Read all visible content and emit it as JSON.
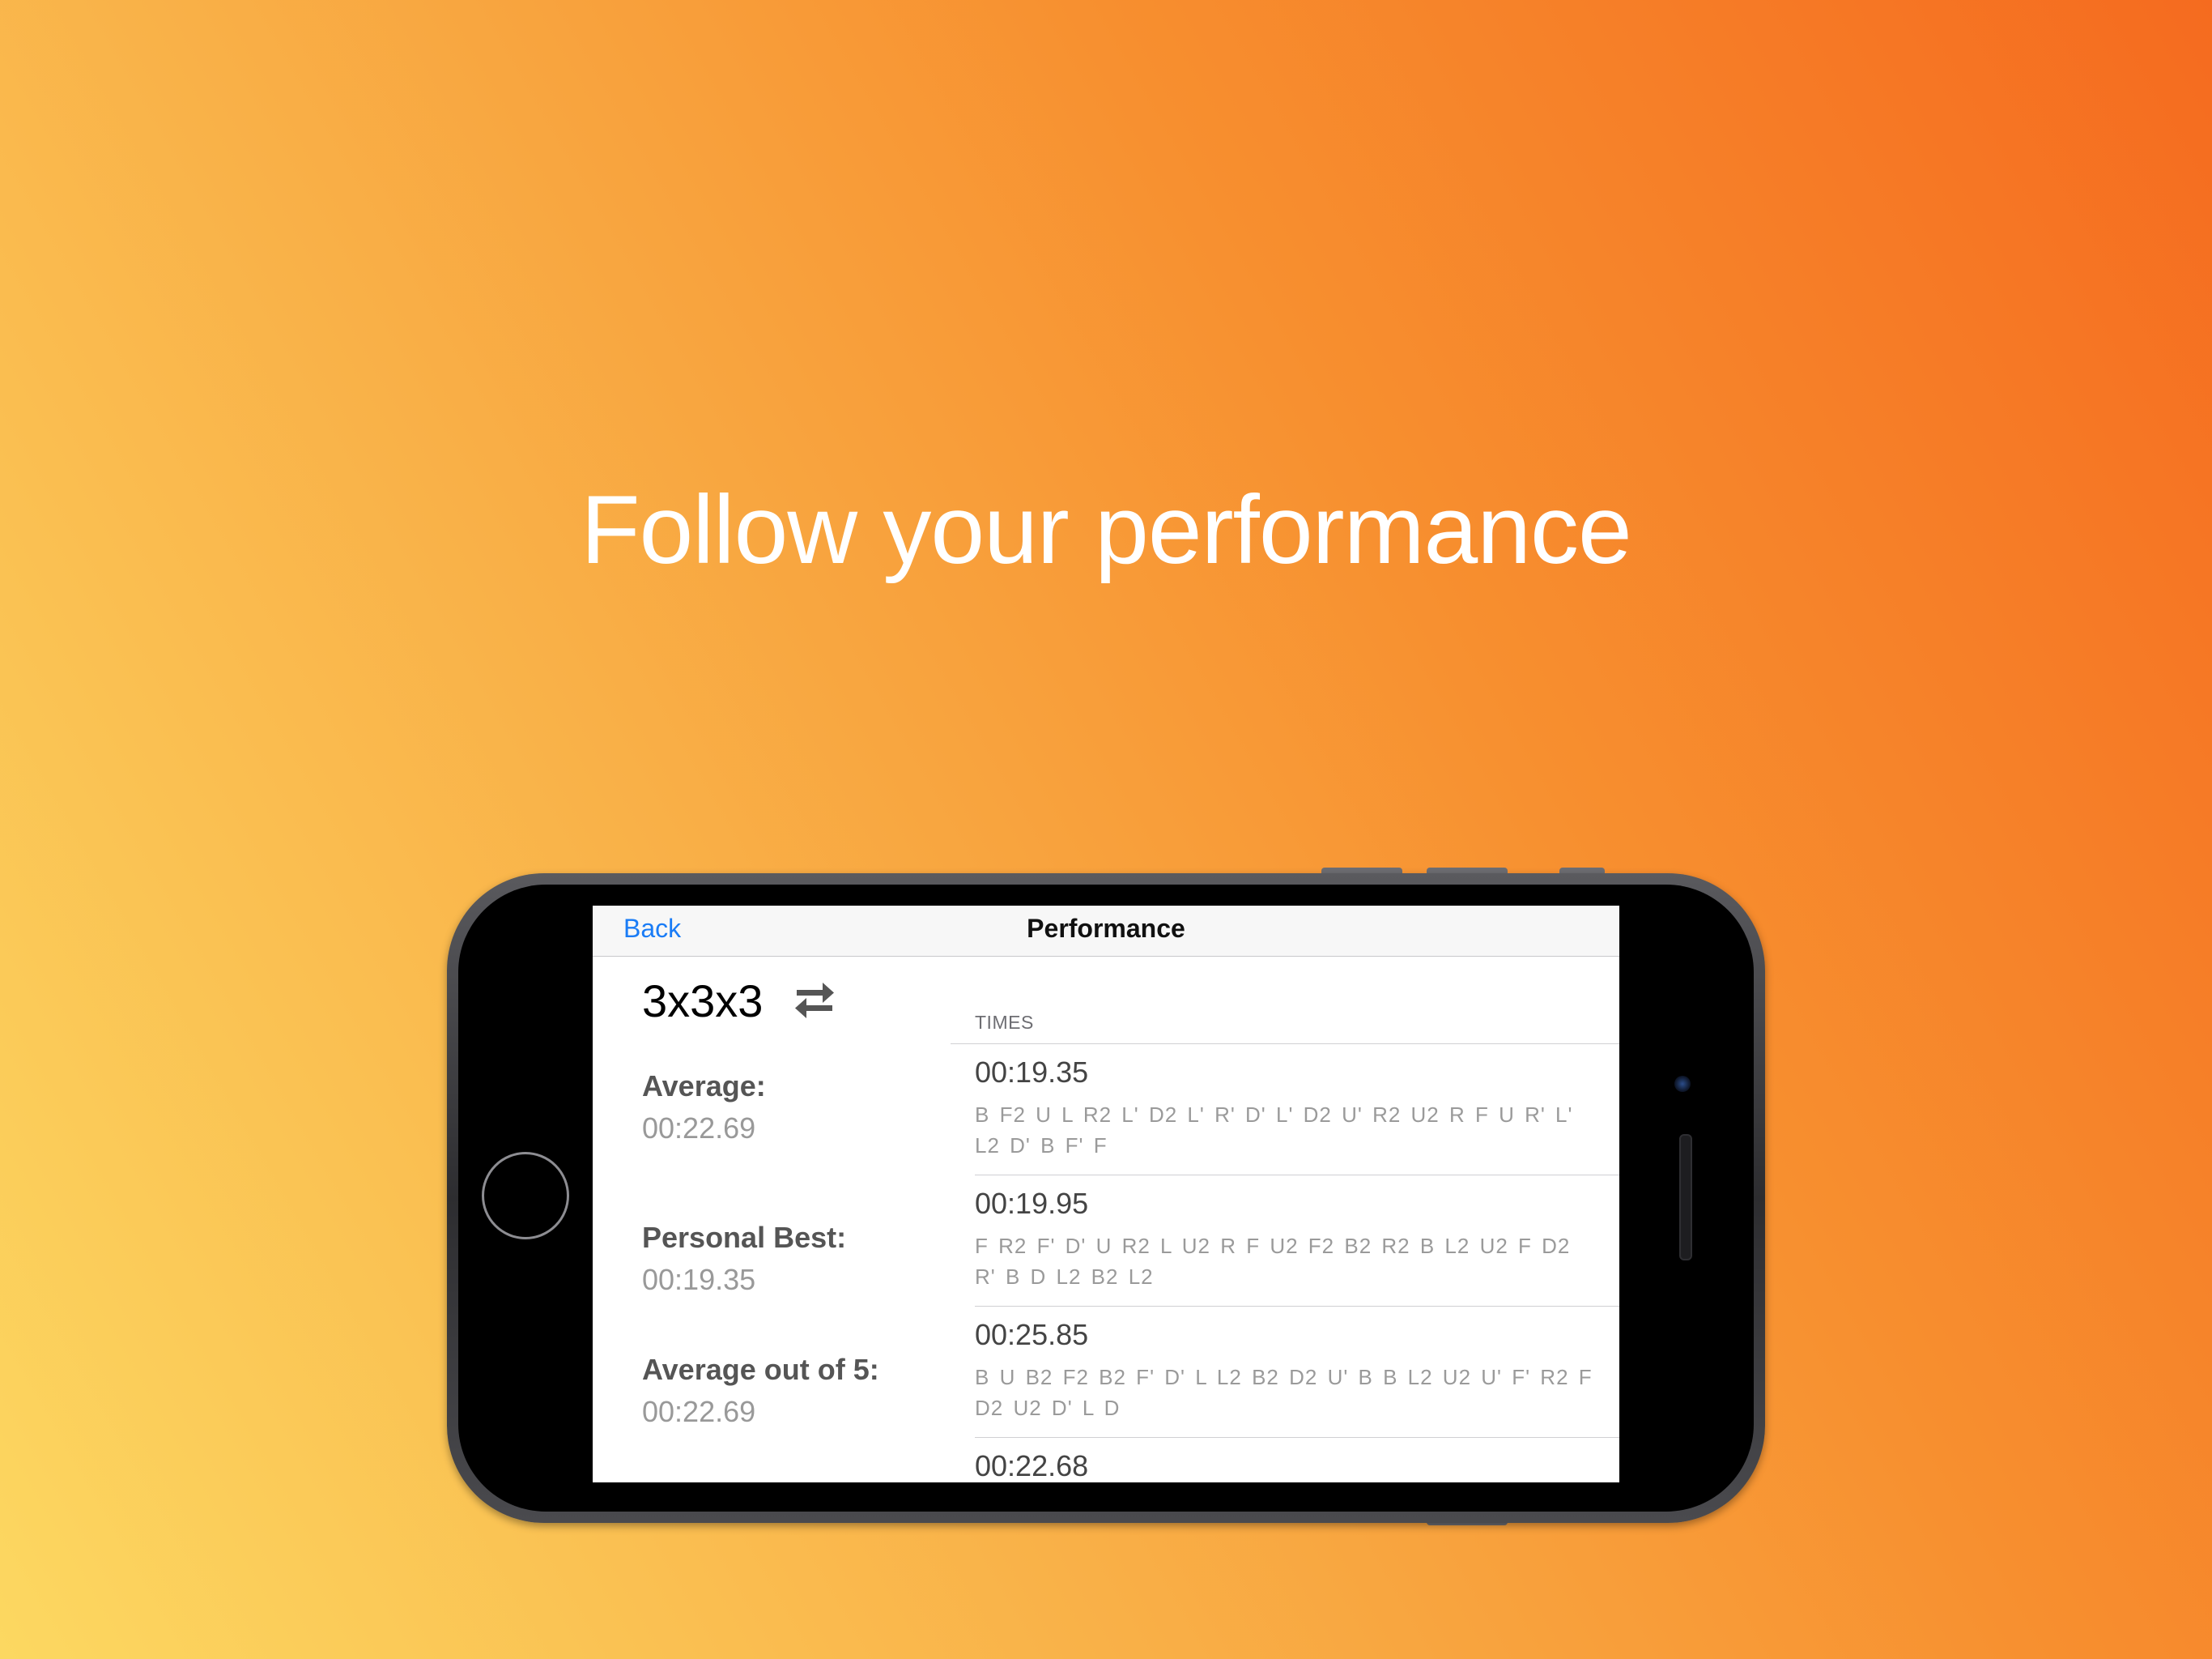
{
  "headline": "Follow your performance",
  "nav": {
    "back_label": "Back",
    "title": "Performance"
  },
  "puzzle": {
    "name": "3x3x3",
    "switch_icon": "swap-arrows-icon"
  },
  "stats": [
    {
      "label": "Average:",
      "value": "00:22.69"
    },
    {
      "label": "Personal Best:",
      "value": "00:19.35"
    },
    {
      "label": "Average out of 5:",
      "value": "00:22.69"
    }
  ],
  "times": {
    "header": "TIMES",
    "items": [
      {
        "time": "00:19.35",
        "scramble": "B F2 U L R2 L' D2 L' R' D' L' D2 U' R2 U2 R F U R' L' L2 D' B F' F"
      },
      {
        "time": "00:19.95",
        "scramble": "F R2 F' D' U R2 L U2 R F U2 F2 B2 R2 B L2 U2 F D2 R' B D L2 B2 L2"
      },
      {
        "time": "00:25.85",
        "scramble": "B U B2 F2 B2 F' D' L L2 B2 D2 U' B B L2 U2 U' F' R2 F D2 U2 D' L D"
      },
      {
        "time": "00:22.68",
        "scramble": ""
      }
    ]
  },
  "colors": {
    "accent": "#1a7cf6",
    "gradient_start": "#fcd861",
    "gradient_end": "#f56b1f"
  }
}
